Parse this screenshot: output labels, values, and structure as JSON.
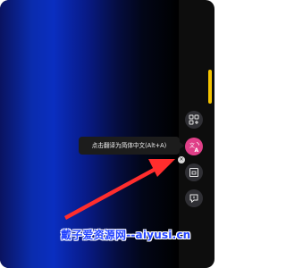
{
  "tooltip": {
    "text": "点击翻译为简体中文(Alt+A)",
    "close_symbol": "×"
  },
  "side_toolbar": {
    "buttons": [
      {
        "name": "apps",
        "icon": "apps-grid-icon"
      },
      {
        "name": "translate",
        "icon": "translate-icon",
        "active_color": "#e03f88"
      },
      {
        "name": "capture",
        "icon": "screenshot-icon"
      },
      {
        "name": "chat",
        "icon": "chat-bubble-icon"
      }
    ]
  },
  "scrollbar": {
    "color": "#f5c400"
  },
  "watermark": {
    "text": "戴子爱资源网--aiyusi.cn"
  },
  "annotation": {
    "arrow_color": "#ff2d2d"
  }
}
